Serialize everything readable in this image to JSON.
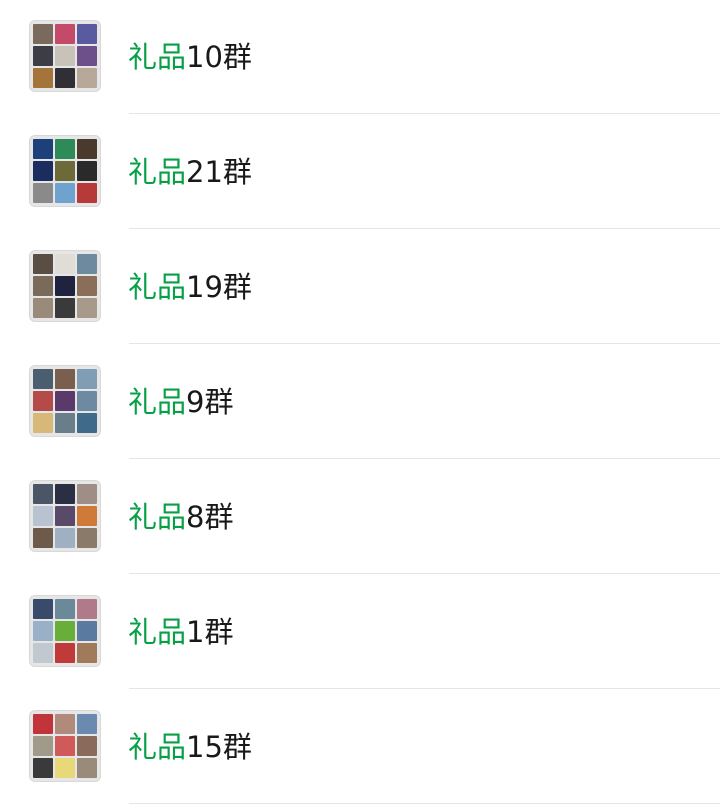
{
  "search_highlight": "礼品",
  "colors": {
    "highlight": "#07a046",
    "text": "#191919",
    "divider": "#e5e5e5"
  },
  "groups": [
    {
      "highlight": "礼品",
      "rest": "10群",
      "avatar_tiles": [
        "#7a6a5e",
        "#c44a6a",
        "#5a5aa0",
        "#3d3d45",
        "#c9c2b8",
        "#6d4f8a",
        "#a5743a",
        "#2f2f35",
        "#b8a89a"
      ]
    },
    {
      "highlight": "礼品",
      "rest": "21群",
      "avatar_tiles": [
        "#1d3f7a",
        "#2e8b57",
        "#4a3a2e",
        "#1b2c5e",
        "#6d6a3a",
        "#2a2a2a",
        "#8a8a8a",
        "#6fa3cf",
        "#b73a3a"
      ]
    },
    {
      "highlight": "礼品",
      "rest": "19群",
      "avatar_tiles": [
        "#5a4e44",
        "#e0dcd6",
        "#6e8a9e",
        "#7a6a5a",
        "#1f2340",
        "#8a6e5a",
        "#9a8a7a",
        "#3a3a3a",
        "#a89a8a"
      ]
    },
    {
      "highlight": "礼品",
      "rest": "9群",
      "avatar_tiles": [
        "#4a5e70",
        "#7a5e4e",
        "#7f9db5",
        "#b54a4a",
        "#5a3a6a",
        "#6e8aa3",
        "#d8b878",
        "#6a7e8a",
        "#3f6a8a"
      ]
    },
    {
      "highlight": "礼品",
      "rest": "8群",
      "avatar_tiles": [
        "#4a5666",
        "#2a2f44",
        "#9e8e86",
        "#b8c2d0",
        "#5a4a6a",
        "#d07a3a",
        "#6e5a4a",
        "#9eb0c2",
        "#8a7a6a"
      ]
    },
    {
      "highlight": "礼品",
      "rest": "1群",
      "avatar_tiles": [
        "#3a4a6a",
        "#6a8a9a",
        "#b07a8a",
        "#9ab0c8",
        "#6aae3a",
        "#5a7aa0",
        "#c0c8d0",
        "#c03a3a",
        "#a07a5a"
      ]
    },
    {
      "highlight": "礼品",
      "rest": "15群",
      "avatar_tiles": [
        "#c0343a",
        "#b08a7a",
        "#6a8ab0",
        "#a09a8a",
        "#d05a5a",
        "#8a6a5a",
        "#3a3a3a",
        "#e8d878",
        "#9a8a7a"
      ]
    }
  ]
}
